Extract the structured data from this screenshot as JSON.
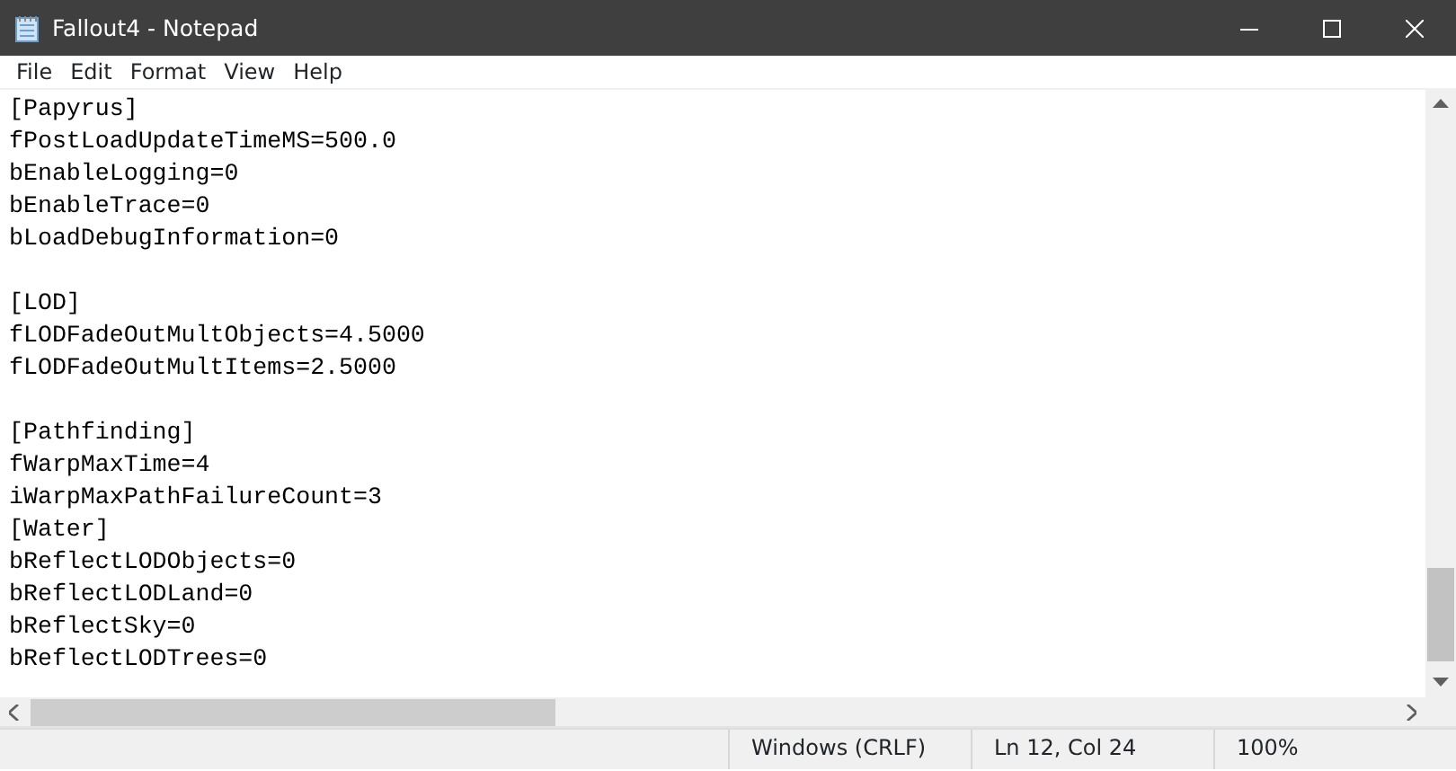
{
  "window": {
    "title": "Fallout4 - Notepad"
  },
  "menu": [
    "File",
    "Edit",
    "Format",
    "View",
    "Help"
  ],
  "editor": {
    "blocks": [
      [
        "[Papyrus]",
        "fPostLoadUpdateTimeMS=500.0",
        "bEnableLogging=0",
        "bEnableTrace=0",
        "bLoadDebugInformation=0"
      ],
      [
        "[LOD]",
        "fLODFadeOutMultObjects=4.5000",
        "fLODFadeOutMultItems=2.5000"
      ],
      [
        "[Pathfinding]",
        "fWarpMaxTime=4",
        "iWarpMaxPathFailureCount=3",
        "[Water]",
        "bReflectLODObjects=0",
        "bReflectLODLand=0",
        "bReflectSky=0",
        "bReflectLODTrees=0"
      ]
    ]
  },
  "status_bar": [
    "Windows (CRLF)",
    "Ln 12, Col 24",
    "100%"
  ]
}
